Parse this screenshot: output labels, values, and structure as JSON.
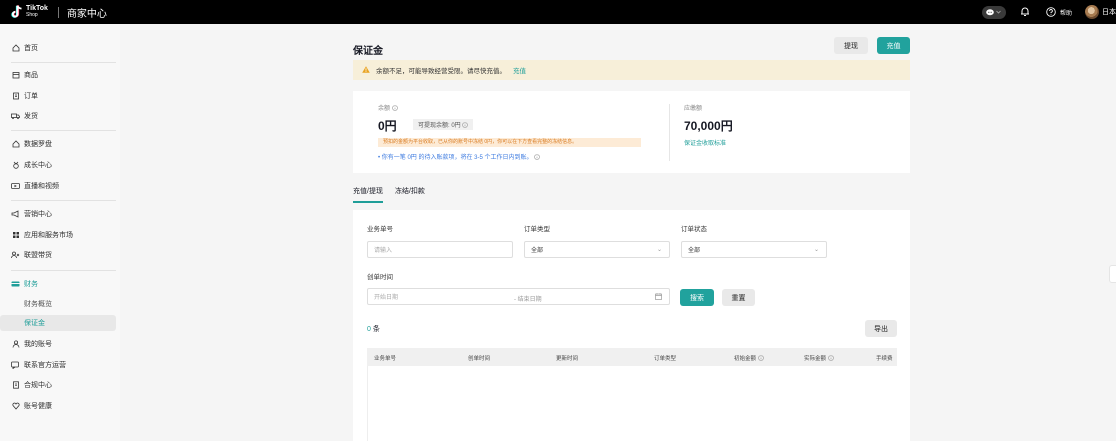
{
  "topbar": {
    "logo_line1": "TikTok",
    "logo_line2": "Shop",
    "app_name": "商家中心",
    "help_label": "帮助",
    "lang_label": "日本"
  },
  "sidebar": {
    "items": [
      {
        "label": "首页",
        "icon": "home-icon"
      },
      {
        "label": "商品",
        "icon": "product-icon"
      },
      {
        "label": "订单",
        "icon": "order-icon"
      },
      {
        "label": "发货",
        "icon": "shipping-icon"
      },
      {
        "label": "数据罗盘",
        "icon": "compass-icon"
      },
      {
        "label": "成长中心",
        "icon": "growth-icon"
      },
      {
        "label": "直播和视频",
        "icon": "live-video-icon"
      },
      {
        "label": "营销中心",
        "icon": "marketing-icon"
      },
      {
        "label": "应用和服务市场",
        "icon": "apps-icon"
      },
      {
        "label": "联盟带货",
        "icon": "affiliate-icon"
      },
      {
        "label": "财务",
        "icon": "finance-icon"
      },
      {
        "label": "财务概览",
        "icon": ""
      },
      {
        "label": "保证金",
        "icon": ""
      },
      {
        "label": "我的账号",
        "icon": "account-icon"
      },
      {
        "label": "联系官方运营",
        "icon": "contact-icon"
      },
      {
        "label": "合规中心",
        "icon": "compliance-icon"
      },
      {
        "label": "账号健康",
        "icon": "health-icon"
      }
    ]
  },
  "page": {
    "title": "保证金",
    "withdraw_label": "提现",
    "recharge_label": "充值"
  },
  "alert": {
    "text": "余额不足，可能导致经营受限。请尽快充值。",
    "link": "充值"
  },
  "balance": {
    "label": "余额",
    "amount": "0円",
    "available_label": "可提现余额: 0円",
    "warning_note": "预扣的金额为平台收取，已从你的账号中冻结 0円，你可以在下方查看完整的冻结信息。",
    "pending_note": "你有一笔 0円 的待入账款项，将在 3-5 个工作日内到账。",
    "required_label": "应缴额",
    "required_amount": "70,000円",
    "standard_link": "保证金收取标准"
  },
  "tabs": [
    {
      "label": "充值/提现",
      "active": true
    },
    {
      "label": "冻结/扣款",
      "active": false
    }
  ],
  "filters": {
    "business_no_label": "业务单号",
    "business_no_placeholder": "请输入",
    "order_type_label": "订单类型",
    "order_type_value": "全部",
    "order_status_label": "订单状态",
    "order_status_value": "全部",
    "created_label": "创单时间",
    "start_placeholder": "开始日期",
    "end_placeholder": "结束日期",
    "search_label": "搜索",
    "reset_label": "重置"
  },
  "results": {
    "count": "0",
    "unit": "条",
    "export_label": "导出"
  },
  "table": {
    "columns": [
      "业务单号",
      "创单时间",
      "更新时间",
      "订单类型",
      "初始金额",
      "实际金额",
      "手续费"
    ]
  },
  "colors": {
    "accent": "#21a29d",
    "alert_bg": "#f7efd9",
    "warning_orange": "#d97a1e",
    "info_blue": "#3d7be0"
  }
}
